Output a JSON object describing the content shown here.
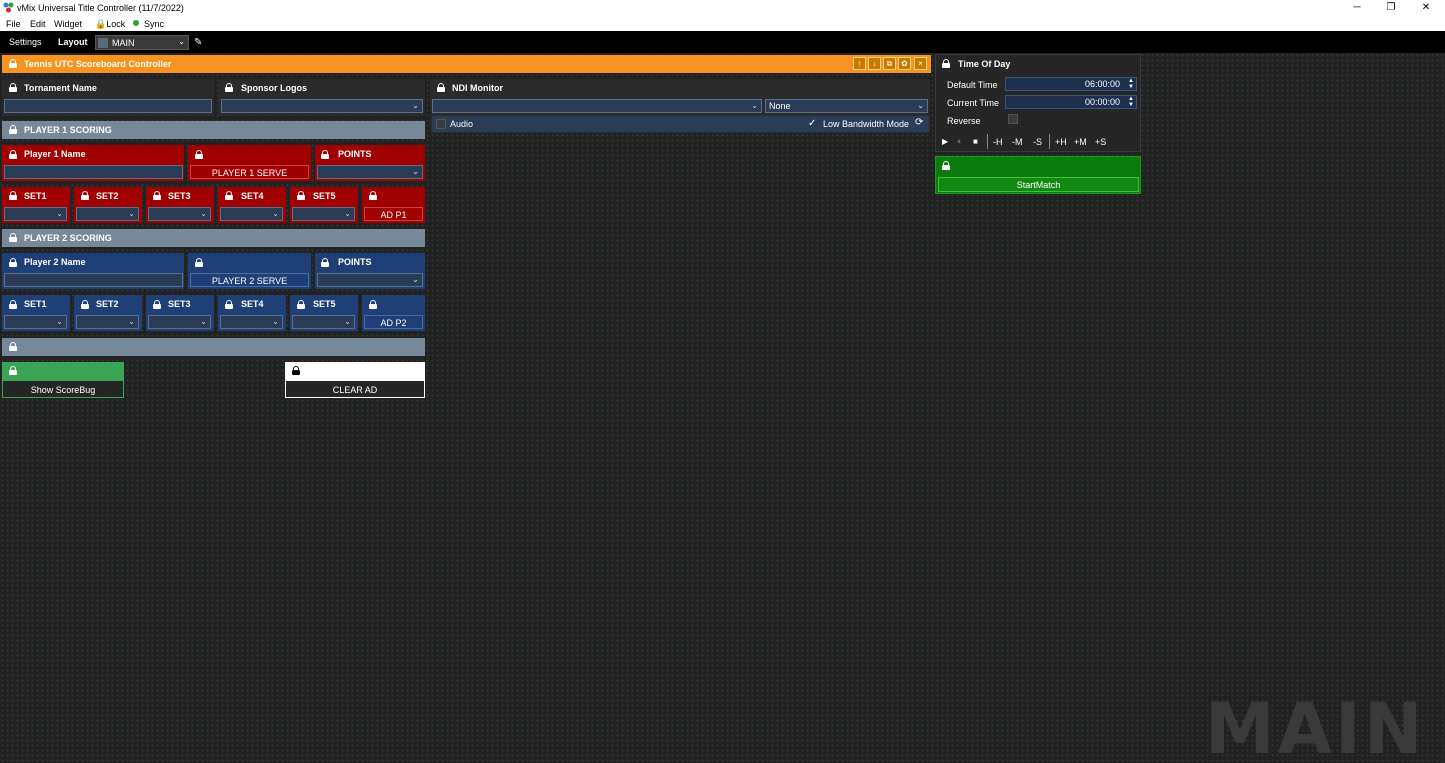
{
  "window": {
    "title": "vMix Universal Title Controller (11/7/2022)",
    "minimize": "─",
    "restore": "❐",
    "close": "✕"
  },
  "menu": {
    "file": "File",
    "edit": "Edit",
    "widget": "Widget",
    "lock": "🔒Lock",
    "sync": "Sync"
  },
  "toolbar": {
    "settings": "Settings",
    "layout": "Layout",
    "layout_value": "MAIN",
    "layout_caret": "⌄",
    "edit_icon": "✎"
  },
  "scoreboard": {
    "title": "Tennis UTC Scoreboard Controller",
    "accent": "#f7931e",
    "tournament_label": "Tornament Name",
    "sponsor_label": "Sponsor Logos",
    "player1": {
      "section": "PLAYER 1 SCORING",
      "name_label": "Player 1 Name",
      "serve": "PLAYER 1 SERVE",
      "points": "POINTS",
      "sets": [
        "SET1",
        "SET2",
        "SET3",
        "SET4",
        "SET5"
      ],
      "ad": "AD P1"
    },
    "player2": {
      "section": "PLAYER 2 SCORING",
      "name_label": "Player 2 Name",
      "serve": "PLAYER 2 SERVE",
      "points": "POINTS",
      "sets": [
        "SET1",
        "SET2",
        "SET3",
        "SET4",
        "SET5"
      ],
      "ad": "AD P2"
    },
    "show_scorebug": "Show ScoreBug",
    "clear_ad": "CLEAR AD"
  },
  "ndi": {
    "title": "NDI Monitor",
    "source_value": "None",
    "audio": "Audio",
    "low_bandwidth": "Low Bandwidth Mode",
    "low_bandwidth_checked": true
  },
  "timeofday": {
    "title": "Time Of Day",
    "default_label": "Default Time",
    "default_value": "06:00:00",
    "current_label": "Current Time",
    "current_value": "00:00:00",
    "reverse_label": "Reverse",
    "controls": {
      "play": "▶",
      "pause": "⏸",
      "stop": "■",
      "minus_h": "-H",
      "minus_m": "-M",
      "minus_s": "-S",
      "plus_h": "+H",
      "plus_m": "+M",
      "plus_s": "+S"
    },
    "start_match": "StartMatch"
  },
  "watermark": "MAIN",
  "colors": {
    "red": "#a10000",
    "blue": "#1f3f77",
    "gray": "#778899",
    "green": "#3aa655",
    "darkgreen": "#0d7a0d"
  }
}
